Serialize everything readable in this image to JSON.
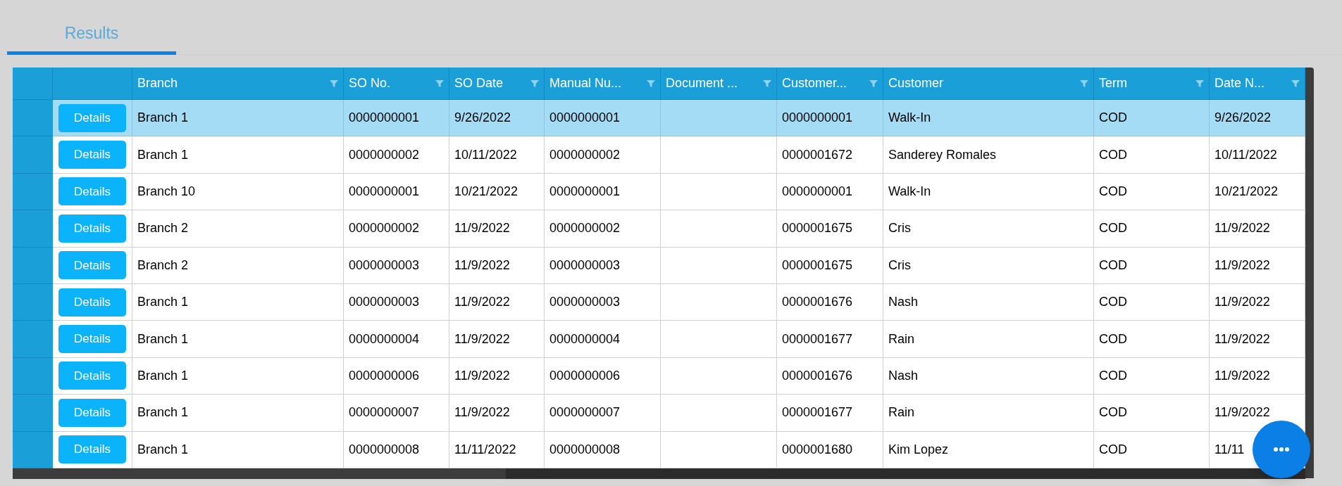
{
  "tabs": [
    {
      "label": "Results",
      "selected": true
    }
  ],
  "grid": {
    "columns": [
      "Branch",
      "SO No.",
      "SO Date",
      "Manual Nu...",
      "Document ...",
      "Customer...",
      "Customer",
      "Term",
      "Date N..."
    ],
    "rows": [
      {
        "selected": true,
        "action": "Details",
        "cells": [
          "Branch 1",
          "0000000001",
          "9/26/2022",
          "0000000001",
          null,
          "0000000001",
          "Walk-In",
          "COD",
          "9/26/2022"
        ]
      },
      {
        "selected": false,
        "action": "Details",
        "cells": [
          "Branch 1",
          "0000000002",
          "10/11/2022",
          "0000000002",
          null,
          "0000001672",
          "Sanderey Romales",
          "COD",
          "10/11/2022"
        ]
      },
      {
        "selected": false,
        "action": "Details",
        "cells": [
          "Branch 10",
          "0000000001",
          "10/21/2022",
          "0000000001",
          null,
          "0000000001",
          "Walk-In",
          "COD",
          "10/21/2022"
        ]
      },
      {
        "selected": false,
        "action": "Details",
        "cells": [
          "Branch 2",
          "0000000002",
          "11/9/2022",
          "0000000002",
          null,
          "0000001675",
          "Cris",
          "COD",
          "11/9/2022"
        ]
      },
      {
        "selected": false,
        "action": "Details",
        "cells": [
          "Branch 2",
          "0000000003",
          "11/9/2022",
          "0000000003",
          null,
          "0000001675",
          "Cris",
          "COD",
          "11/9/2022"
        ]
      },
      {
        "selected": false,
        "action": "Details",
        "cells": [
          "Branch 1",
          "0000000003",
          "11/9/2022",
          "0000000003",
          null,
          "0000001676",
          "Nash",
          "COD",
          "11/9/2022"
        ]
      },
      {
        "selected": false,
        "action": "Details",
        "cells": [
          "Branch 1",
          "0000000004",
          "11/9/2022",
          "0000000004",
          null,
          "0000001677",
          "Rain",
          "COD",
          "11/9/2022"
        ]
      },
      {
        "selected": false,
        "action": "Details",
        "cells": [
          "Branch 1",
          "0000000006",
          "11/9/2022",
          "0000000006",
          null,
          "0000001676",
          "Nash",
          "COD",
          "11/9/2022"
        ]
      },
      {
        "selected": false,
        "action": "Details",
        "cells": [
          "Branch 1",
          "0000000007",
          "11/9/2022",
          "0000000007",
          null,
          "0000001677",
          "Rain",
          "COD",
          "11/9/2022"
        ]
      },
      {
        "selected": false,
        "action": "Details",
        "cells": [
          "Branch 1",
          "0000000008",
          "11/11/2022",
          "0000000008",
          null,
          "0000001680",
          "Kim Lopez",
          "COD",
          "11/11"
        ]
      }
    ]
  }
}
